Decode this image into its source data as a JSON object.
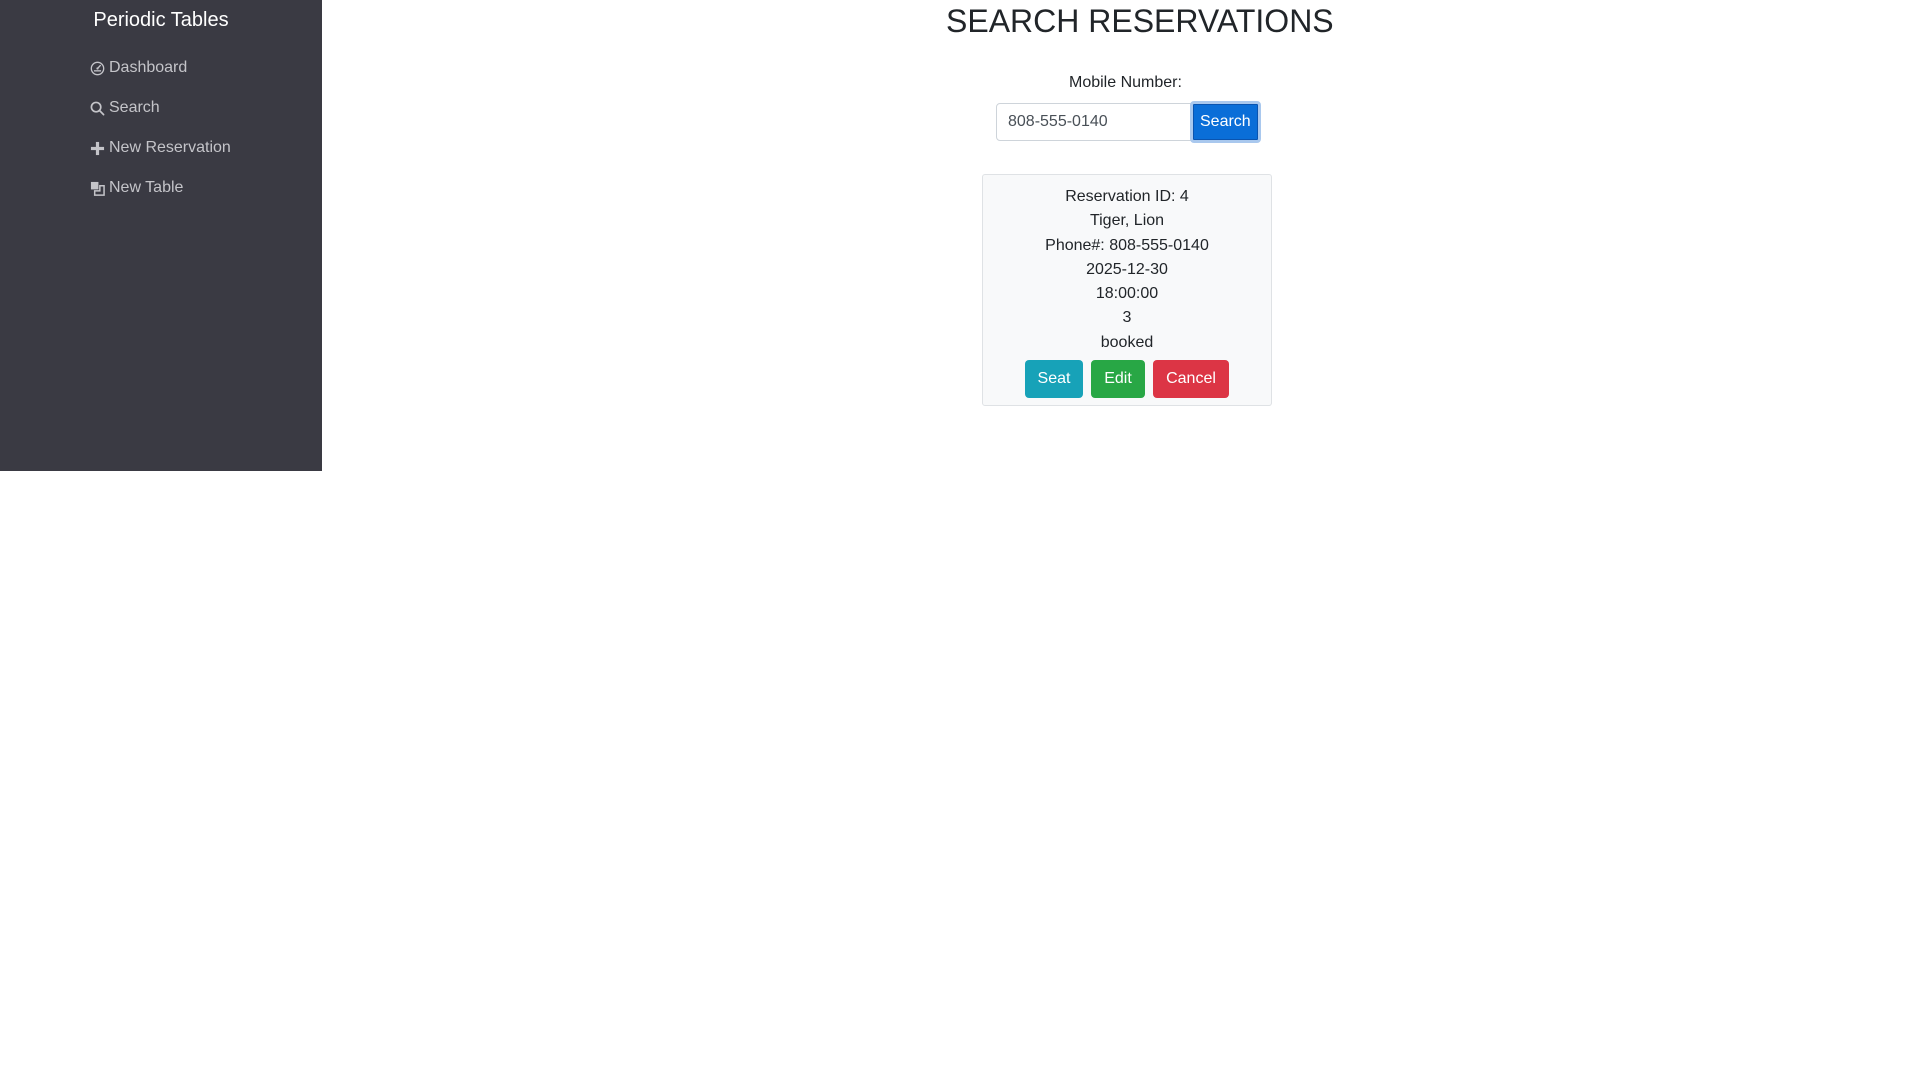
{
  "sidebar": {
    "brand": "Periodic Tables",
    "items": [
      {
        "label": "Dashboard",
        "icon": "dashboard-icon"
      },
      {
        "label": "Search",
        "icon": "search-icon"
      },
      {
        "label": "New Reservation",
        "icon": "plus-icon"
      },
      {
        "label": "New Table",
        "icon": "layers-icon"
      }
    ]
  },
  "main": {
    "title": "SEARCH RESERVATIONS",
    "search": {
      "label": "Mobile Number:",
      "value": "808-555-0140",
      "button_label": "Search"
    },
    "reservation": {
      "id_line": "Reservation ID: 4",
      "name": "Tiger, Lion",
      "phone_line": "Phone#: 808-555-0140",
      "date": "2025-12-30",
      "time": "18:00:00",
      "people": "3",
      "status": "booked",
      "actions": {
        "seat": "Seat",
        "edit": "Edit",
        "cancel": "Cancel"
      }
    }
  },
  "colors": {
    "sidebar_bg": "#3a3a43",
    "primary": "#0a6ed8",
    "seat": "#17a2b8",
    "edit": "#28a745",
    "cancel": "#dc3545"
  }
}
